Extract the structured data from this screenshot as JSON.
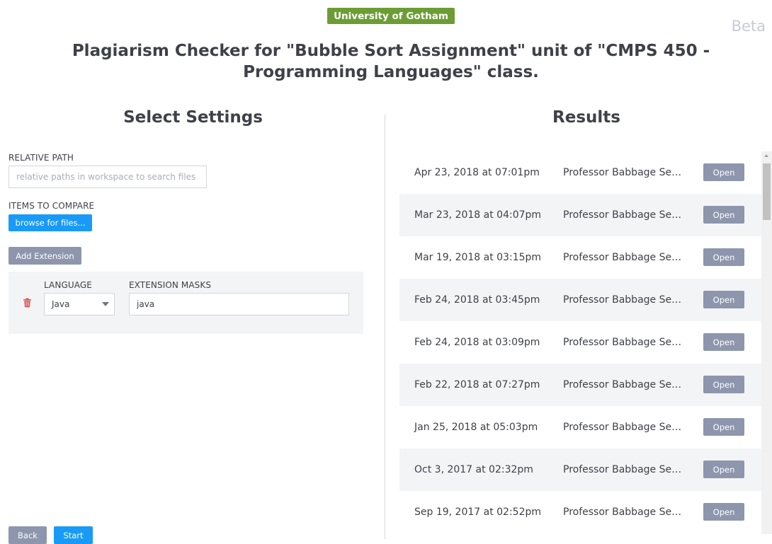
{
  "header": {
    "institution": "University of Gotham",
    "beta_label": "Beta",
    "title": "Plagiarism Checker for \"Bubble Sort Assignment\" unit of \"CMPS 450 - Programming Languages\" class."
  },
  "settings": {
    "section_title": "Select Settings",
    "relative_path_label": "RELATIVE PATH",
    "relative_path_placeholder": "relative paths in workspace to search files in",
    "relative_path_value": "",
    "items_to_compare_label": "ITEMS TO COMPARE",
    "browse_button": "browse for files...",
    "add_extension_button": "Add Extension",
    "extension": {
      "language_label": "LANGUAGE",
      "language_value": "Java",
      "masks_label": "EXTENSION MASKS",
      "masks_value": "java",
      "delete_icon": "trash-icon"
    },
    "back_button": "Back",
    "start_button": "Start"
  },
  "results": {
    "section_title": "Results",
    "open_label": "Open",
    "rows": [
      {
        "date": "Apr 23, 2018 at 07:01pm",
        "author": "Professor Babbage Senior"
      },
      {
        "date": "Mar 23, 2018 at 04:07pm",
        "author": "Professor Babbage Senior"
      },
      {
        "date": "Mar 19, 2018 at 03:15pm",
        "author": "Professor Babbage Senior"
      },
      {
        "date": "Feb 24, 2018 at 03:45pm",
        "author": "Professor Babbage Senior"
      },
      {
        "date": "Feb 24, 2018 at 03:09pm",
        "author": "Professor Babbage Senior"
      },
      {
        "date": "Feb 22, 2018 at 07:27pm",
        "author": "Professor Babbage Senior"
      },
      {
        "date": "Jan 25, 2018 at 05:03pm",
        "author": "Professor Babbage Senior"
      },
      {
        "date": "Oct 3, 2017 at 02:32pm",
        "author": "Professor Babbage Senior"
      },
      {
        "date": "Sep 19, 2017 at 02:52pm",
        "author": "Professor Babbage Senior"
      }
    ]
  },
  "colors": {
    "institution_badge": "#6c9d34",
    "primary_button": "#1a9af7",
    "secondary_button": "#8d96ad",
    "delete_icon": "#e05252"
  }
}
